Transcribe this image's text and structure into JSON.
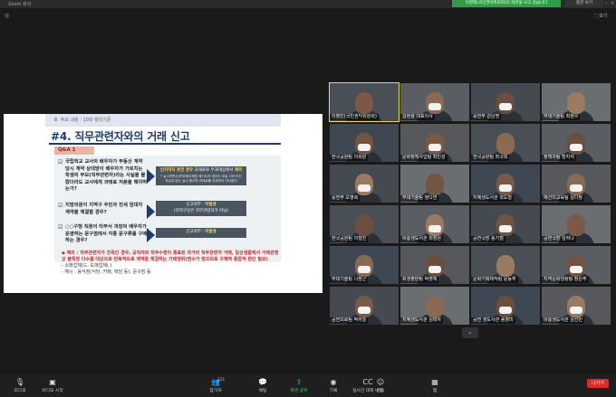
{
  "window": {
    "title": "Zoom 회의"
  },
  "banner": {
    "text": "이영택(국민권익위원회)의 화면을 보고 있습니다"
  },
  "view_button": {
    "label": "옵션 보기"
  },
  "top_right": {
    "expand_label": "보기"
  },
  "slide": {
    "header": "Ⅲ. 주요 내용 : 10대 행위기준",
    "title": "#4. 직무관련자와의 거래 신고",
    "qa_label": "Q&A 1",
    "questions": [
      "국립학교 교사의 배우자가 부동산 계약 당시 계약 상대방이 배우자가 가르치는 학생의 부모(직무관련자)라는 사실을 몰랐더라도 교사에게 과태료 처분을 해야하는가?",
      "지방의원이 지역구 주민과 전세 임대차 계약을 체결할 경우?",
      "○○구청 직원이 타부서 과장의 배우자가 운영하는 문구점에서 각종 문구류를 구매하는 경우?"
    ],
    "answers": [
      {
        "hl": "인지하지 못한 경우",
        "pre": "",
        "mid": " 과태료로 부과대상에서 ",
        "hl2": "제외",
        "sub": "* 실시하면서(반부패규제법 제7조)의 경우는 과실 고의 또는 과실이 없는 실시 했으면 과태료를 부과하지 아니한다"
      },
      {
        "hl": "미발생",
        "pre": "신고의무 : ",
        "sub": "(지역구민은 직무관련자가 아님)"
      },
      {
        "hl": "미발생",
        "pre": "신고의무 : ",
        "sub": ""
      }
    ],
    "note_main": "◆ 예외 : 직무관련자가 친족인 경우, 공직자와 직무수행이 종료된 과거의 직무관련자 거래, 일상생활에서 거래관행상 불특정 다수를 대상으로 반복적으로 계약을 체결하는 거래행위(변수가 많으므로 구체적 종합적 판단 필요)",
    "note_sub1": "- 소매업체(드, 도매업체(.)",
    "note_sub2": "- 예시 : 음식점(식당, 카페, 택담 등), 문구점 등"
  },
  "participants": [
    {
      "name": "이병민(국민권익위원회)",
      "active": true
    },
    {
      "name": "김현광 대표이사"
    },
    {
      "name": "웅연부 김남명"
    },
    {
      "name": "무대기술팀 최정우"
    },
    {
      "name": "한국공원팀 이희원"
    },
    {
      "name": "문화정책사업팀 최민성"
    },
    {
      "name": "한국공원팀 최국희"
    },
    {
      "name": "정책과팀 장지석"
    },
    {
      "name": "웅연부 오영록"
    },
    {
      "name": "무대기술팀 정다연"
    },
    {
      "name": "지혜생도서관 곽도형"
    },
    {
      "name": "예선미교육팀 김다정"
    },
    {
      "name": "한국공원팀 이철진"
    },
    {
      "name": "비룡생도서관 최정원"
    },
    {
      "name": "공연국장 송기철"
    },
    {
      "name": "공연국장 김하나"
    },
    {
      "name": "부대기술팀 나장군"
    },
    {
      "name": "회생출판팀 박영재"
    },
    {
      "name": "문화기획제작팀 윤동주"
    },
    {
      "name": "지역문화생활팀 정은주"
    },
    {
      "name": "공연프로팀 박하늘"
    },
    {
      "name": "지혜생도서관 김태자"
    },
    {
      "name": "공연 생도사관 송영미"
    },
    {
      "name": "비룡생도서관 김선민"
    }
  ],
  "toolbar": [
    {
      "label": "오디오",
      "icon": "mic-off-icon"
    },
    {
      "label": "비디오 시작",
      "icon": "video-off-icon"
    },
    {
      "label": "참가자",
      "icon": "participants-icon",
      "count": "123"
    },
    {
      "label": "채팅",
      "icon": "chat-icon"
    },
    {
      "label": "화면 공유",
      "icon": "share-screen-icon"
    },
    {
      "label": "기록",
      "icon": "record-icon"
    },
    {
      "label": "실시간 대화 내용",
      "icon": "cc-icon"
    },
    {
      "label": "반응",
      "icon": "reactions-icon"
    },
    {
      "label": "앱",
      "icon": "apps-icon"
    }
  ],
  "leave_button": {
    "label": "나가기"
  },
  "colors": {
    "share_green": "#39d353",
    "leave_red": "#e02828",
    "active_speaker": "#e9e337",
    "slide_navy": "#1f3b6e"
  }
}
